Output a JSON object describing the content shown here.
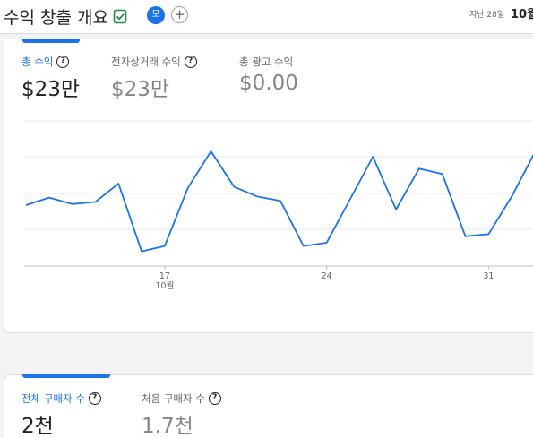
{
  "header": {
    "title": "수익 창출 개요",
    "avatar_initial": "모",
    "add_label": "+",
    "date_prefix": "지난 28일",
    "date_value": "10월"
  },
  "revenue_card": {
    "metrics": [
      {
        "label": "총 수익",
        "value": "$23만",
        "active": true
      },
      {
        "label": "전자상거래 수익",
        "value": "$23만",
        "active": false
      },
      {
        "label": "총 광고 수익",
        "value": "$0.00",
        "active": false,
        "no_help": true
      }
    ]
  },
  "purchasers_card": {
    "metrics": [
      {
        "label": "전체 구매자 수",
        "value": "2천",
        "active": true
      },
      {
        "label": "처음 구매자 수",
        "value": "1.7천",
        "active": false
      }
    ]
  },
  "chart_data": {
    "type": "line",
    "x_tick_labels": [
      {
        "day": "17",
        "month": "10월"
      },
      {
        "day": "24",
        "month": ""
      },
      {
        "day": "31",
        "month": ""
      }
    ],
    "series": [
      {
        "color": "#1a73e8",
        "values": [
          0.5,
          0.57,
          0.51,
          0.53,
          0.7,
          0.07,
          0.12,
          0.66,
          1.0,
          0.67,
          0.58,
          0.54,
          0.12,
          0.15,
          0.55,
          0.95,
          0.46,
          0.84,
          0.79,
          0.21,
          0.23,
          0.58,
          0.99
        ]
      }
    ]
  }
}
